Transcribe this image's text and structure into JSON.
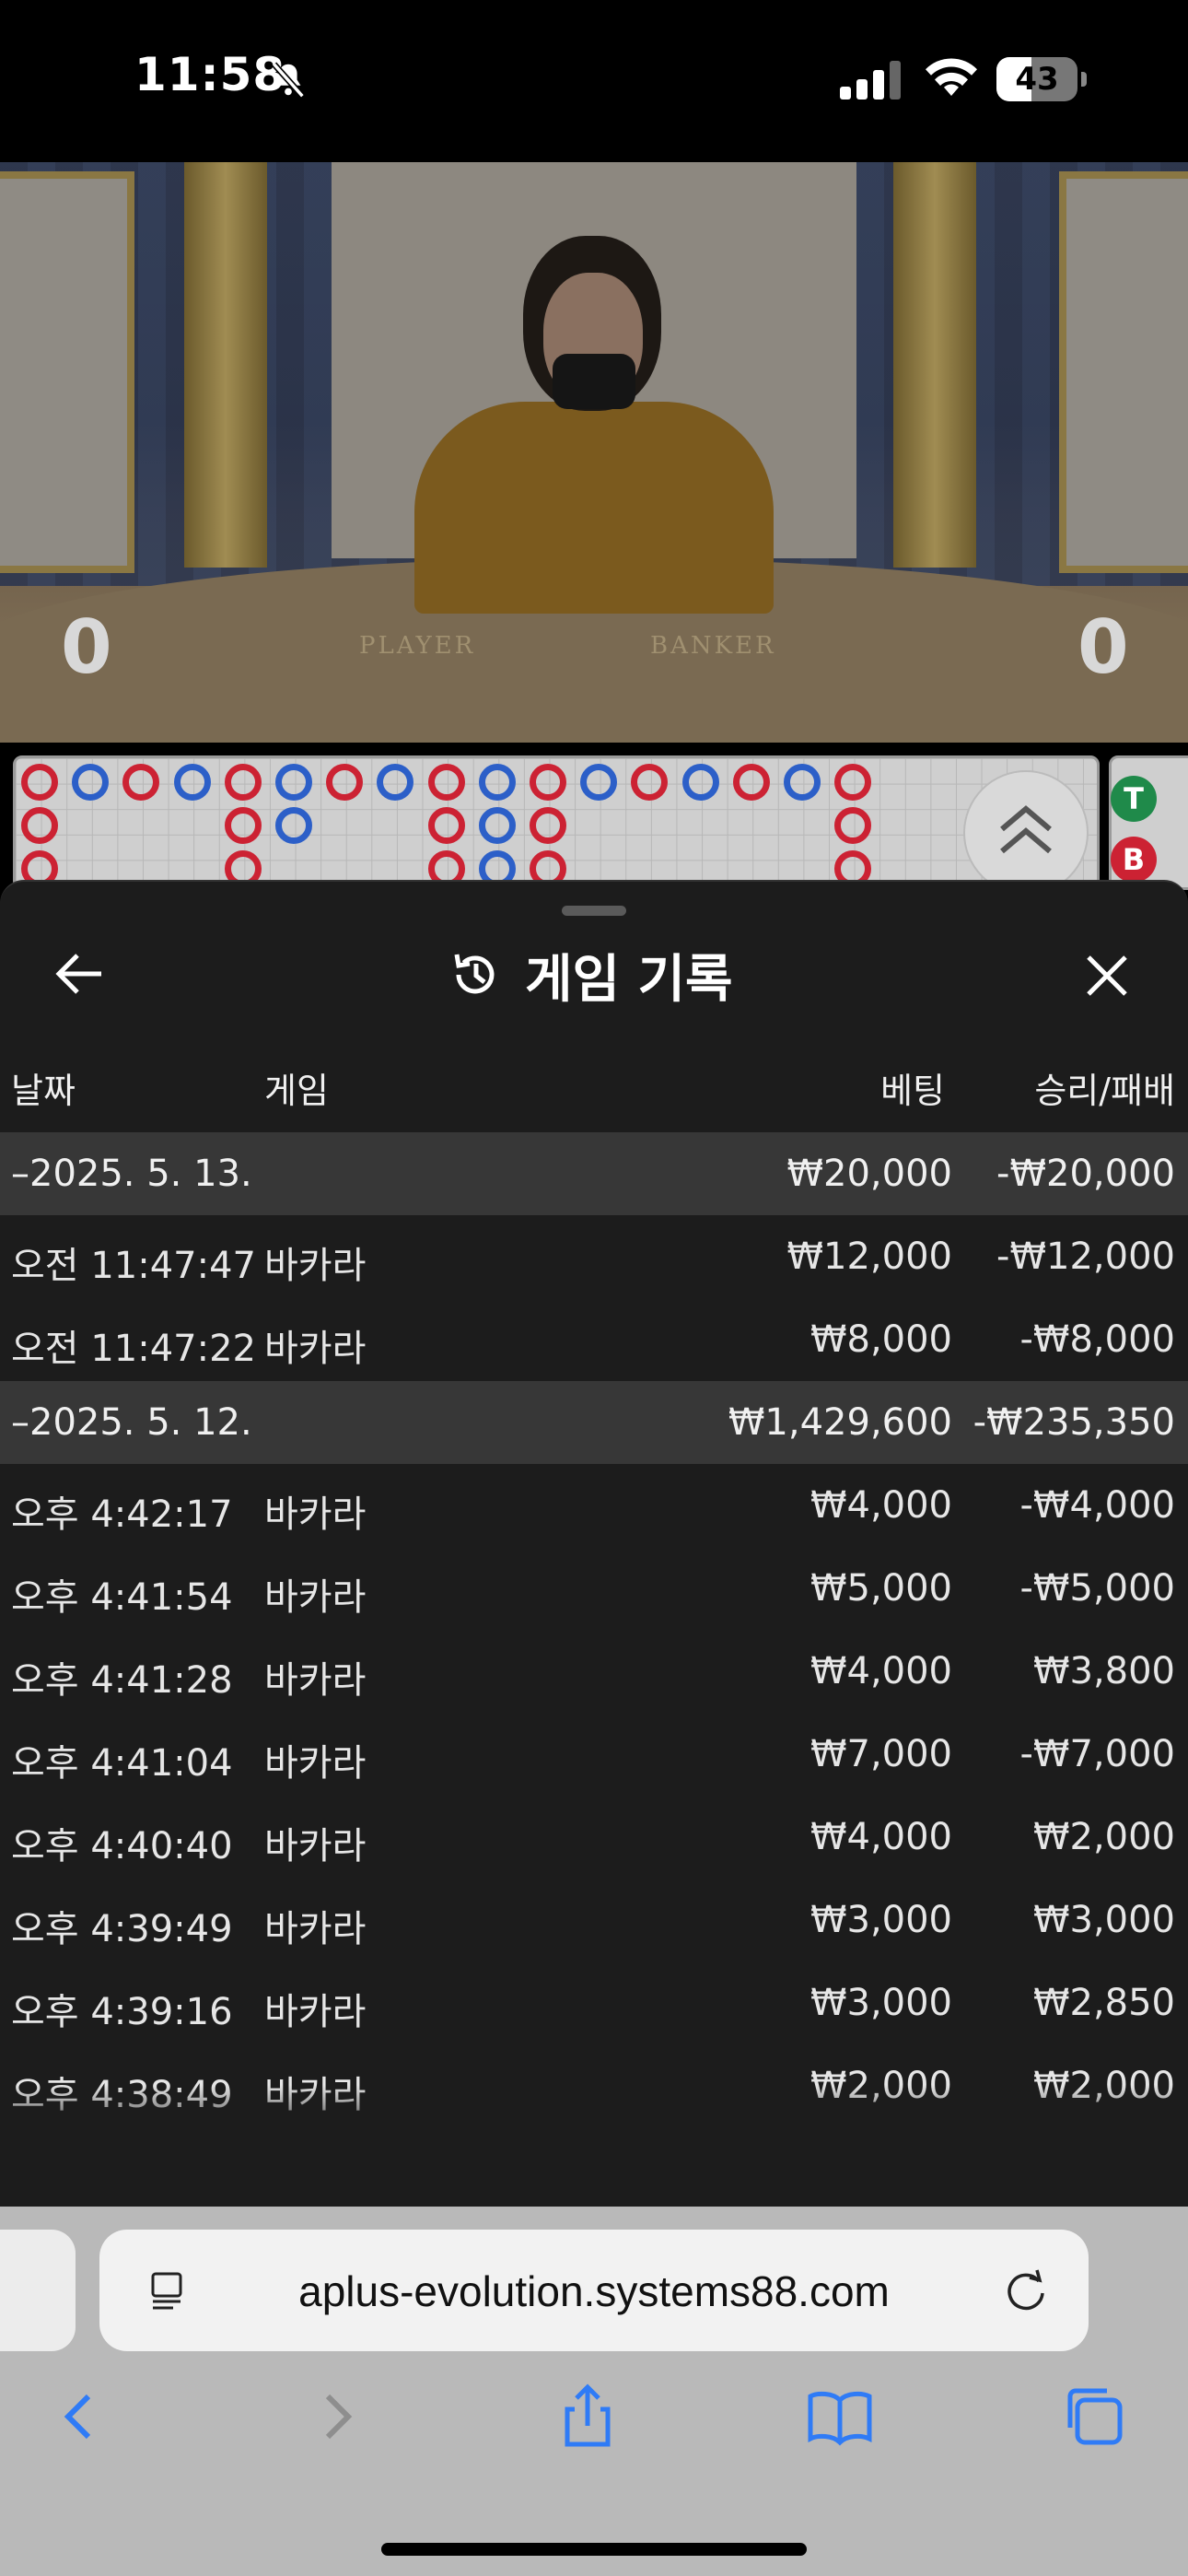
{
  "status_bar": {
    "time": "11:58",
    "battery": "43",
    "battery_level": 0.43
  },
  "video": {
    "player_score": "0",
    "banker_score": "0",
    "player_label": "PLAYER",
    "banker_label": "BANKER"
  },
  "side_road": {
    "tie": "T",
    "banker": "B"
  },
  "sheet": {
    "title": "게임 기록",
    "headers": {
      "date": "날짜",
      "game": "게임",
      "bet": "베팅",
      "result": "승리/패배"
    },
    "groups": [
      {
        "date": "–2025. 5. 13.",
        "bet": "₩20,000",
        "result": "-₩20,000",
        "rows": [
          {
            "time": "오전 11:47:47",
            "game": "바카라",
            "bet": "₩12,000",
            "result": "-₩12,000"
          },
          {
            "time": "오전 11:47:22",
            "game": "바카라",
            "bet": "₩8,000",
            "result": "-₩8,000"
          }
        ]
      },
      {
        "date": "–2025. 5. 12.",
        "bet": "₩1,429,600",
        "result": "-₩235,350",
        "rows": [
          {
            "time": "오후 4:42:17",
            "game": "바카라",
            "bet": "₩4,000",
            "result": "-₩4,000"
          },
          {
            "time": "오후 4:41:54",
            "game": "바카라",
            "bet": "₩5,000",
            "result": "-₩5,000"
          },
          {
            "time": "오후 4:41:28",
            "game": "바카라",
            "bet": "₩4,000",
            "result": "₩3,800"
          },
          {
            "time": "오후 4:41:04",
            "game": "바카라",
            "bet": "₩7,000",
            "result": "-₩7,000"
          },
          {
            "time": "오후 4:40:40",
            "game": "바카라",
            "bet": "₩4,000",
            "result": "₩2,000"
          },
          {
            "time": "오후 4:39:49",
            "game": "바카라",
            "bet": "₩3,000",
            "result": "₩3,000"
          },
          {
            "time": "오후 4:39:16",
            "game": "바카라",
            "bet": "₩3,000",
            "result": "₩2,850"
          },
          {
            "time": "오후 4:38:49",
            "game": "바카라",
            "bet": "₩2,000",
            "result": "₩2,000"
          }
        ]
      }
    ]
  },
  "browser": {
    "url": "aplus-evolution.systems88.com"
  },
  "colors": {
    "sheet_bg": "#1c1c1c",
    "group_bg": "#373737",
    "banker_red": "#c23",
    "player_blue": "#2c5fc8",
    "ios_blue": "#2f7bf6"
  }
}
